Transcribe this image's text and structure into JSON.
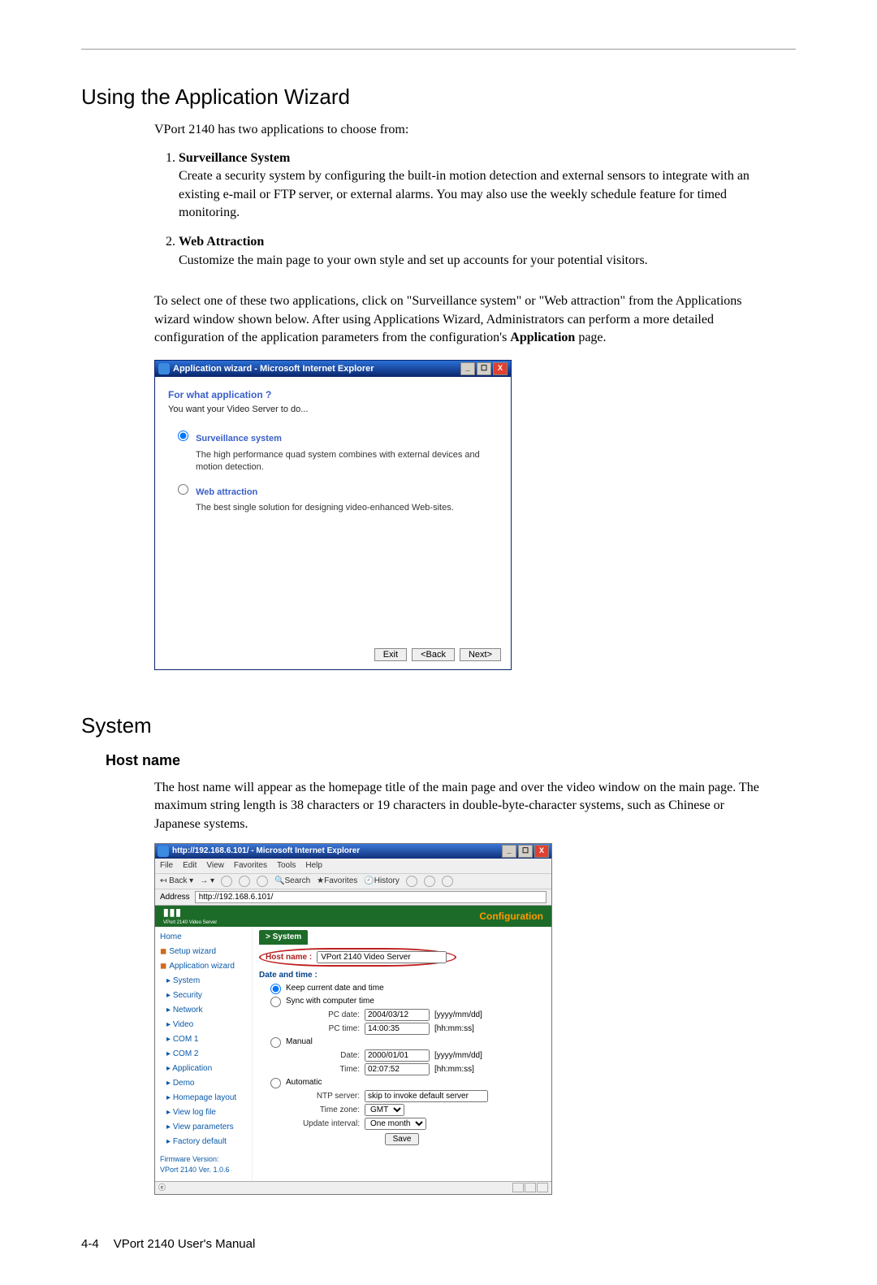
{
  "page": {
    "section1_title": "Using the Application Wizard",
    "intro": "VPort 2140 has two applications to choose from:",
    "apps": [
      {
        "title": "Surveillance System",
        "desc": "Create a security system by configuring the built-in motion detection and external sensors to integrate with an existing e-mail or FTP server, or external alarms. You may also use the weekly schedule feature for timed monitoring."
      },
      {
        "title": "Web Attraction",
        "desc": "Customize the main page to your own style and set up accounts for your potential visitors."
      }
    ],
    "followup_before": "To select one of these two applications, click on \"Surveillance system\" or \"Web attraction\" from the Applications wizard window shown below. After using Applications Wizard, Administrators can perform a more detailed configuration of the application parameters from the configuration's ",
    "followup_bold": "Application",
    "followup_after": " page.",
    "section2_title": "System",
    "sub_heading": "Host name",
    "hostname_para": "The host name will appear as the homepage title of the main page and over the video window on the main page. The maximum string length is 38 characters or 19 characters in double-byte-character systems, such as Chinese or Japanese systems."
  },
  "wizard": {
    "title": "Application wizard - Microsoft Internet Explorer",
    "question": "For what application ?",
    "subtitle": "You want your Video Server to do...",
    "opt1_label": "Surveillance system",
    "opt1_desc": "The high performance quad system combines with external devices and motion detection.",
    "opt2_label": "Web attraction",
    "opt2_desc": "The best single solution for designing video-enhanced Web-sites.",
    "opt1_selected": true,
    "btn_exit": "Exit",
    "btn_back": "<Back",
    "btn_next": "Next>"
  },
  "config": {
    "window_title": "http://192.168.6.101/ - Microsoft Internet Explorer",
    "menus": [
      "File",
      "Edit",
      "View",
      "Favorites",
      "Tools",
      "Help"
    ],
    "toolbar": {
      "back_label": "Back",
      "search_label": "Search",
      "favorites_label": "Favorites",
      "history_label": "History"
    },
    "address_label": "Address",
    "address_value": "http://192.168.6.101/",
    "brand_text": "",
    "brand_sub": "VPort 2140 Video Server",
    "brand_right": "Configuration",
    "sidebar": {
      "home": "Home",
      "setup_wizard": "Setup wizard",
      "app_wizard": "Application wizard",
      "items": [
        "System",
        "Security",
        "Network",
        "Video",
        "COM 1",
        "COM 2",
        "Application",
        "Demo",
        "Homepage layout",
        "View log file",
        "View parameters",
        "Factory default"
      ],
      "firmware_label": "Firmware Version:",
      "firmware_value": "VPort 2140 Ver. 1.0.6"
    },
    "content": {
      "tab_label": "> System",
      "host_label": "Host name :",
      "host_value": "VPort 2140 Video Server",
      "date_legend": "Date and time :",
      "opt_keep": "Keep current date and time",
      "opt_sync": "Sync with computer time",
      "pc_date_label": "PC date:",
      "pc_date_value": "2004/03/12",
      "pc_date_hint": "[yyyy/mm/dd]",
      "pc_time_label": "PC time:",
      "pc_time_value": "14:00:35",
      "pc_time_hint": "[hh:mm:ss]",
      "opt_manual": "Manual",
      "manual_date_label": "Date:",
      "manual_date_value": "2000/01/01",
      "manual_date_hint": "[yyyy/mm/dd]",
      "manual_time_label": "Time:",
      "manual_time_value": "02:07:52",
      "manual_time_hint": "[hh:mm:ss]",
      "opt_auto": "Automatic",
      "ntp_label": "NTP server:",
      "ntp_value": "skip to invoke default server",
      "tz_label": "Time zone:",
      "tz_value": "GMT",
      "update_label": "Update interval:",
      "update_value": "One month",
      "save_label": "Save"
    },
    "status_left_icon": "ie"
  },
  "footer": {
    "page_number": "4-4",
    "manual": "VPort 2140 User's Manual"
  }
}
